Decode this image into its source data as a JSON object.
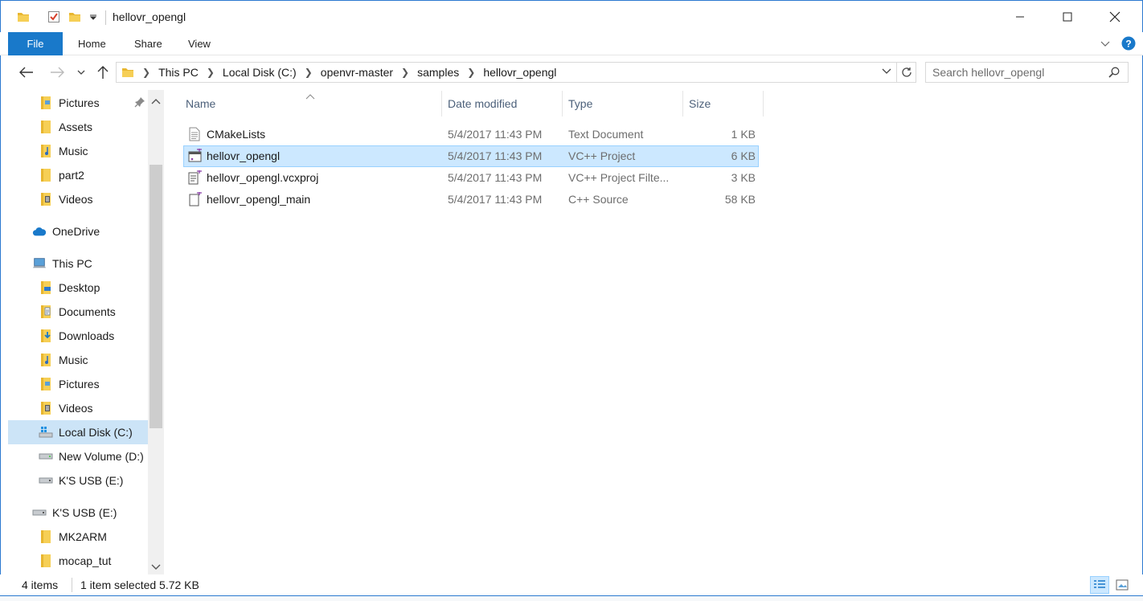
{
  "window": {
    "title": "hellovr_opengl"
  },
  "ribbon": {
    "tabs": [
      {
        "label": "File"
      },
      {
        "label": "Home"
      },
      {
        "label": "Share"
      },
      {
        "label": "View"
      }
    ]
  },
  "address": {
    "crumbs": [
      "This PC",
      "Local Disk (C:)",
      "openvr-master",
      "samples",
      "hellovr_opengl"
    ],
    "search_placeholder": "Search hellovr_opengl"
  },
  "nav": {
    "items": [
      {
        "label": "Pictures",
        "icon": "pictures-folder-icon",
        "pinned": true
      },
      {
        "label": "Assets",
        "icon": "folder-icon"
      },
      {
        "label": "Music",
        "icon": "music-folder-icon"
      },
      {
        "label": "part2",
        "icon": "folder-icon"
      },
      {
        "label": "Videos",
        "icon": "videos-folder-icon"
      },
      {
        "label": "OneDrive",
        "icon": "onedrive-cloud-icon"
      },
      {
        "label": "This PC",
        "icon": "computer-icon"
      },
      {
        "label": "Desktop",
        "icon": "desktop-folder-icon"
      },
      {
        "label": "Documents",
        "icon": "documents-folder-icon"
      },
      {
        "label": "Downloads",
        "icon": "downloads-folder-icon"
      },
      {
        "label": "Music",
        "icon": "music-folder-icon"
      },
      {
        "label": "Pictures",
        "icon": "pictures-folder-icon"
      },
      {
        "label": "Videos",
        "icon": "videos-folder-icon"
      },
      {
        "label": "Local Disk (C:)",
        "icon": "windows-drive-icon",
        "selected": true
      },
      {
        "label": "New Volume (D:)",
        "icon": "drive-icon"
      },
      {
        "label": "K'S USB (E:)",
        "icon": "usb-drive-icon"
      },
      {
        "label": "K'S USB (E:)",
        "icon": "usb-drive-icon"
      },
      {
        "label": "MK2ARM",
        "icon": "folder-icon"
      },
      {
        "label": "mocap_tut",
        "icon": "folder-icon"
      }
    ]
  },
  "files": {
    "columns": [
      "Name",
      "Date modified",
      "Type",
      "Size"
    ],
    "rows": [
      {
        "name": "CMakeLists",
        "date": "5/4/2017 11:43 PM",
        "type": "Text Document",
        "size": "1 KB",
        "icon": "text-document-icon"
      },
      {
        "name": "hellovr_opengl",
        "date": "5/4/2017 11:43 PM",
        "type": "VC++ Project",
        "size": "6 KB",
        "icon": "vcxproj-icon",
        "selected": true
      },
      {
        "name": "hellovr_opengl.vcxproj",
        "date": "5/4/2017 11:43 PM",
        "type": "VC++ Project Filte...",
        "size": "3 KB",
        "icon": "vcxproj-filters-icon"
      },
      {
        "name": "hellovr_opengl_main",
        "date": "5/4/2017 11:43 PM",
        "type": "C++ Source",
        "size": "58 KB",
        "icon": "cpp-source-icon"
      }
    ]
  },
  "status": {
    "item_count": "4 items",
    "selection": "1 item selected  5.72 KB"
  },
  "colors": {
    "accent": "#1979ca",
    "selection": "#cce8ff",
    "nav_selection": "#cce4f7",
    "header_text": "#4c607a"
  }
}
